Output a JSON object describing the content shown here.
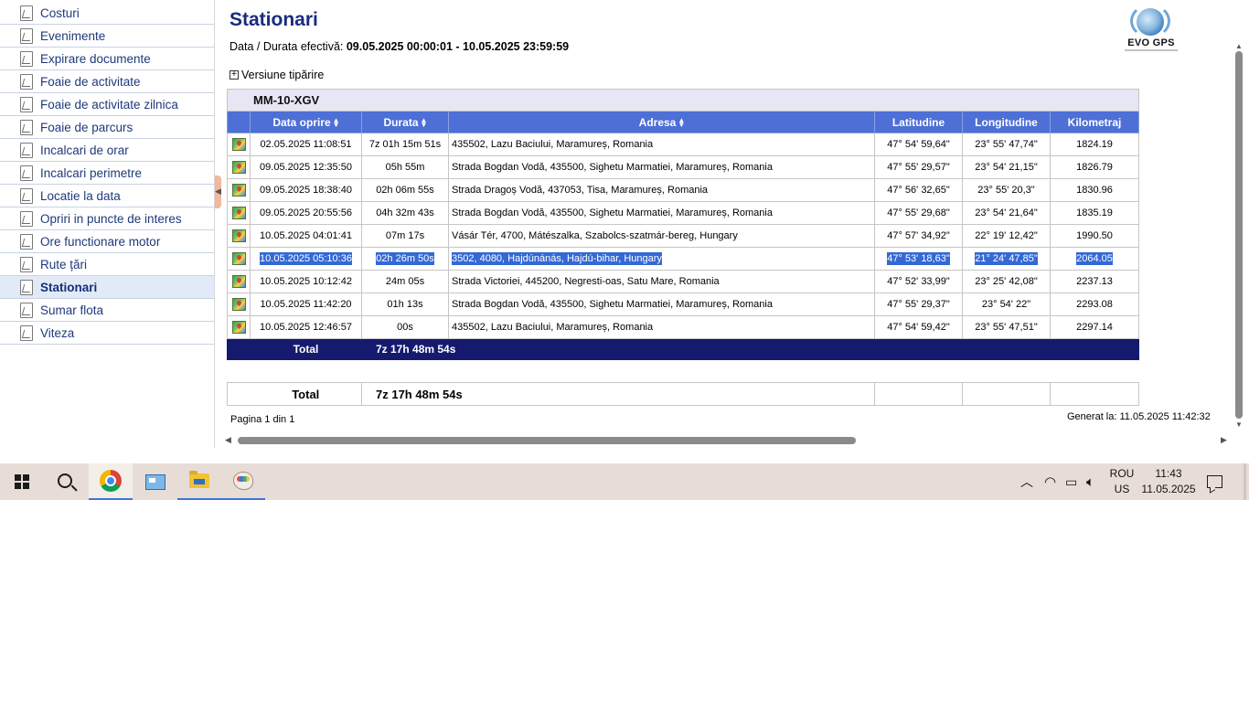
{
  "sidebar": {
    "items": [
      {
        "label": "Costuri"
      },
      {
        "label": "Evenimente"
      },
      {
        "label": "Expirare documente"
      },
      {
        "label": "Foaie de activitate"
      },
      {
        "label": "Foaie de activitate zilnica"
      },
      {
        "label": "Foaie de parcurs"
      },
      {
        "label": "Incalcari de orar"
      },
      {
        "label": "Incalcari perimetre"
      },
      {
        "label": "Locatie la data"
      },
      {
        "label": "Opriri in puncte de interes"
      },
      {
        "label": "Ore functionare motor"
      },
      {
        "label": "Rute țări"
      },
      {
        "label": "Stationari"
      },
      {
        "label": "Sumar flota"
      },
      {
        "label": "Viteza"
      }
    ],
    "active_index": 12
  },
  "report": {
    "title": "Stationari",
    "date_range_label": "Data / Durata efectivă:",
    "date_range_value": "09.05.2025 00:00:01 - 10.05.2025 23:59:59",
    "print_label": "Versiune tipărire",
    "logo_text": "EVO GPS",
    "vehicle": "MM-10-XGV",
    "columns": [
      "Data oprire",
      "Durata",
      "Adresa",
      "Latitudine",
      "Longitudine",
      "Kilometraj"
    ],
    "rows": [
      {
        "date": "02.05.2025 11:08:51",
        "duration": "7z 01h 15m 51s",
        "address": "435502, Lazu Baciului, Maramureș, Romania",
        "lat": "47° 54' 59,64\"",
        "lon": "23° 55' 47,74\"",
        "km": "1824.19"
      },
      {
        "date": "09.05.2025 12:35:50",
        "duration": "05h 55m",
        "address": "Strada Bogdan Vodă,  435500, Sighetu Marmatiei, Maramureș, Romania",
        "lat": "47° 55' 29,57\"",
        "lon": "23° 54' 21,15\"",
        "km": "1826.79"
      },
      {
        "date": "09.05.2025 18:38:40",
        "duration": "02h 06m 55s",
        "address": "Strada Dragoș Vodă,  437053, Tisa, Maramureș, Romania",
        "lat": "47° 56' 32,65\"",
        "lon": "23° 55' 20,3\"",
        "km": "1830.96"
      },
      {
        "date": "09.05.2025 20:55:56",
        "duration": "04h 32m 43s",
        "address": "Strada Bogdan Vodă,  435500, Sighetu Marmatiei, Maramureș, Romania",
        "lat": "47° 55' 29,68\"",
        "lon": "23° 54' 21,64\"",
        "km": "1835.19"
      },
      {
        "date": "10.05.2025 04:01:41",
        "duration": "07m 17s",
        "address": "Vásár Tér,  4700, Mátészalka, Szabolcs-szatmár-bereg, Hungary",
        "lat": "47° 57' 34,92\"",
        "lon": "22° 19' 12,42\"",
        "km": "1990.50"
      },
      {
        "date": "10.05.2025 05:10:36",
        "duration": "02h 26m 50s",
        "address": "3502,  4080, Hajdúnánás, Hajdú-bihar, Hungary",
        "lat": "47° 53' 18,63\"",
        "lon": "21° 24' 47,85\"",
        "km": "2064.05",
        "selected": true
      },
      {
        "date": "10.05.2025 10:12:42",
        "duration": "24m 05s",
        "address": "Strada Victoriei,  445200, Negresti-oas, Satu Mare, Romania",
        "lat": "47° 52' 33,99\"",
        "lon": "23° 25' 42,08\"",
        "km": "2237.13"
      },
      {
        "date": "10.05.2025 11:42:20",
        "duration": "01h 13s",
        "address": "Strada Bogdan Vodă,  435500, Sighetu Marmatiei, Maramureș, Romania",
        "lat": "47° 55' 29,37\"",
        "lon": "23° 54' 22\"",
        "km": "2293.08"
      },
      {
        "date": "10.05.2025 12:46:57",
        "duration": "00s",
        "address": "435502, Lazu Baciului, Maramureș, Romania",
        "lat": "47° 54' 59,42\"",
        "lon": "23° 55' 47,51\"",
        "km": "2297.14"
      }
    ],
    "total_label": "Total",
    "total_value": "7z 17h 48m 54s",
    "grand_total_label": "Total",
    "grand_total_value": "7z 17h 48m 54s",
    "pager": "Pagina 1 din 1",
    "generated": "Generat la: 11.05.2025 11:42:32"
  },
  "taskbar": {
    "lang_1": "ROU",
    "lang_2": "US",
    "time": "11:43",
    "date": "11.05.2025"
  },
  "colors": {
    "header_blue": "#4d6fd6",
    "total_navy": "#161a6e",
    "selection_blue": "#3469d5",
    "title_color": "#1a2b7d"
  }
}
